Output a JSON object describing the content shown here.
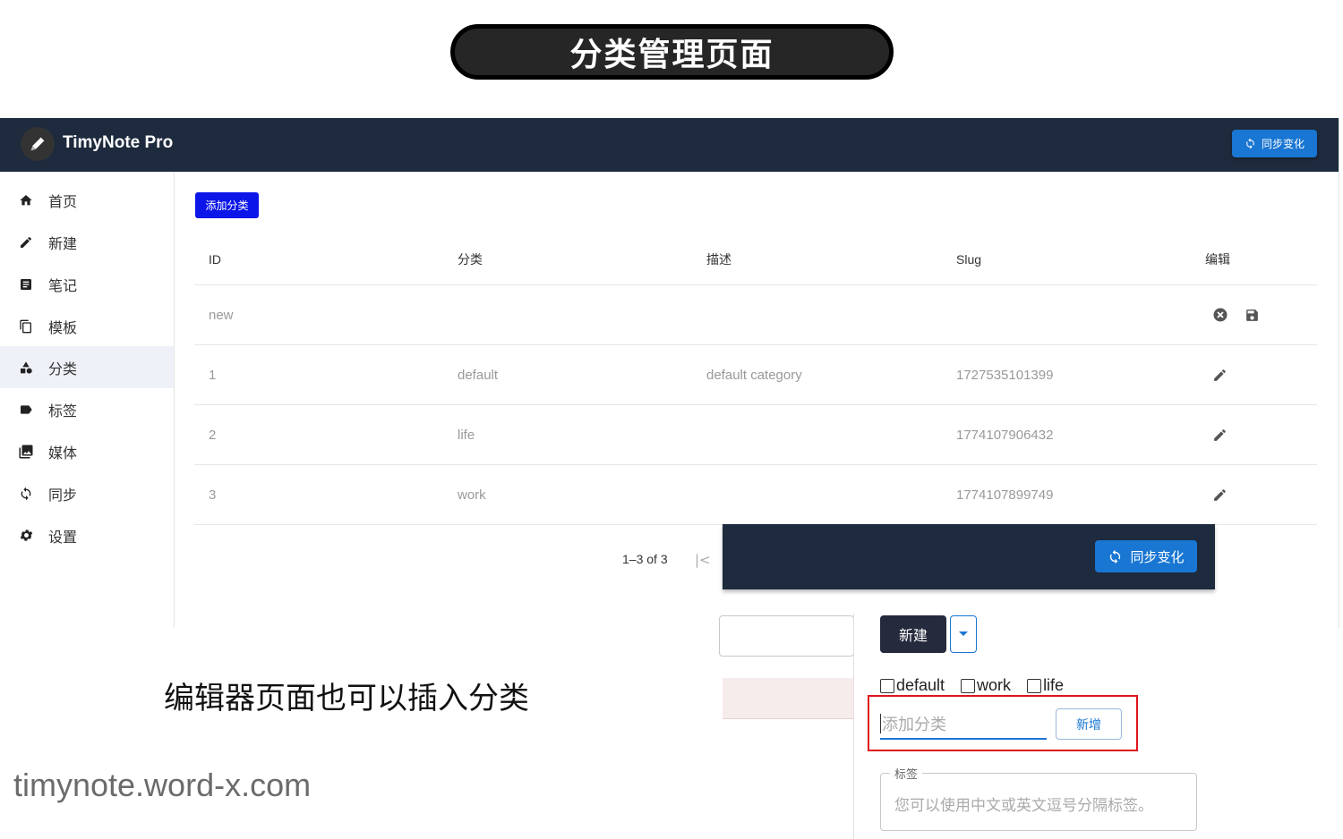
{
  "banner": {
    "title": "分类管理页面"
  },
  "appbar": {
    "title": "TimyNote Pro",
    "sync_label": "同步变化"
  },
  "sidebar": {
    "items": [
      {
        "label": "首页",
        "icon": "home-icon"
      },
      {
        "label": "新建",
        "icon": "pencil-icon"
      },
      {
        "label": "笔记",
        "icon": "note-icon"
      },
      {
        "label": "模板",
        "icon": "copy-icon"
      },
      {
        "label": "分类",
        "icon": "category-icon",
        "active": true
      },
      {
        "label": "标签",
        "icon": "label-icon"
      },
      {
        "label": "媒体",
        "icon": "media-icon"
      },
      {
        "label": "同步",
        "icon": "sync-icon"
      },
      {
        "label": "设置",
        "icon": "gear-icon"
      }
    ]
  },
  "toolbar": {
    "add_category_label": "添加分类"
  },
  "table": {
    "headers": {
      "id": "ID",
      "category": "分类",
      "description": "描述",
      "slug": "Slug",
      "edit": "编辑"
    },
    "new_row": {
      "id": "new"
    },
    "rows": [
      {
        "id": "1",
        "category": "default",
        "description": "default category",
        "slug": "1727535101399"
      },
      {
        "id": "2",
        "category": "life",
        "description": "",
        "slug": "1774107906432"
      },
      {
        "id": "3",
        "category": "work",
        "description": "",
        "slug": "1774107899749"
      }
    ]
  },
  "pagination": {
    "range": "1–3 of 3",
    "first_icon": "|<"
  },
  "editor": {
    "sync_label": "同步变化",
    "new_label": "新建",
    "categories": [
      "default",
      "work",
      "life"
    ],
    "category_input_placeholder": "添加分类",
    "add_new_label": "新增",
    "tags_legend": "标签",
    "tags_placeholder": "您可以使用中文或英文逗号分隔标签。"
  },
  "caption": "编辑器页面也可以插入分类",
  "watermark": "timynote.word-x.com",
  "colors": {
    "appbar": "#1e2a3d",
    "primary": "#1976d2",
    "add_button": "#0c16e8",
    "highlight": "#e0141c"
  }
}
